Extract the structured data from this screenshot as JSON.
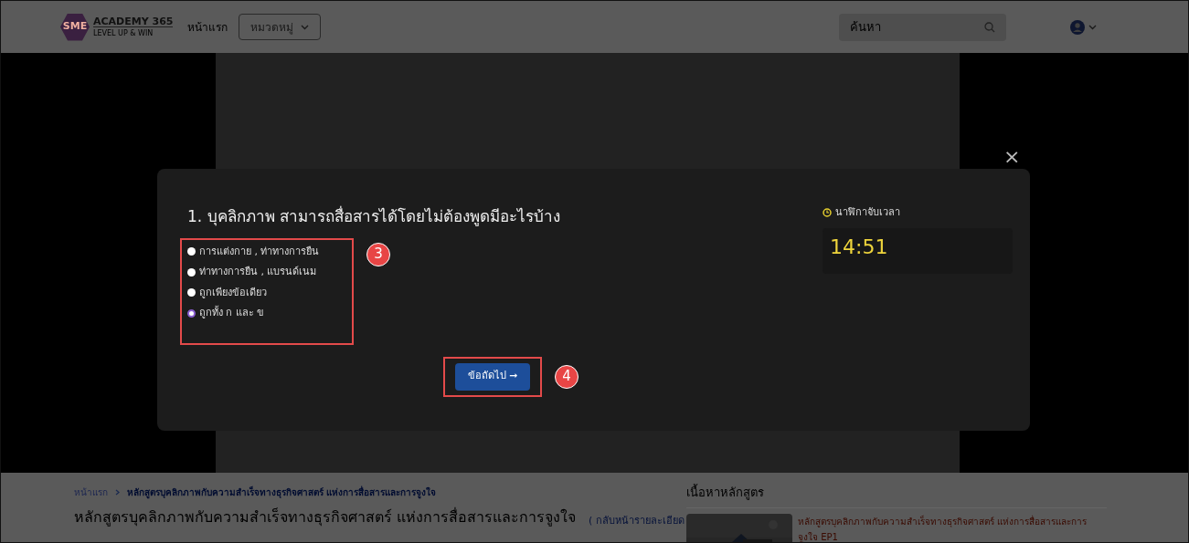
{
  "header": {
    "logo": {
      "mark": "SME",
      "name": "ACADEMY 365",
      "tagline": "LEVEL UP & WIN"
    },
    "nav": [
      {
        "label": "หน้าแรก",
        "kind": "link"
      },
      {
        "label": "หมวดหมู่",
        "kind": "dropdown"
      }
    ],
    "search": {
      "placeholder": "ค้นหา"
    }
  },
  "quiz": {
    "question": "1. บุคลิกภาพ สามารถสื่อสารได้โดยไม่ต้องพูดมีอะไรบ้าง",
    "options": [
      {
        "label": "การแต่งกาย , ท่าทางการยืน",
        "selected": false
      },
      {
        "label": "ท่าทางการยืน , แบรนด์เนม",
        "selected": false
      },
      {
        "label": "ถูกเพียงข้อเดียว",
        "selected": false
      },
      {
        "label": "ถูกทั้ง ก และ ข",
        "selected": true
      }
    ],
    "next_button": "ข้อถัดไป ➞",
    "timer_label": "นาฬิกาจับเวลา",
    "timer": "14:51",
    "close": "×"
  },
  "annotations": [
    {
      "label": "3"
    },
    {
      "label": "4"
    }
  ],
  "breadcrumb": [
    {
      "label": "หน้าแรก",
      "current": false
    },
    {
      "label": "หลักสูตรบุคลิกภาพกับความสำเร็จทางธุรกิจศาสตร์ แห่งการสื่อสารและการจูงใจ",
      "current": true
    }
  ],
  "course_title": "หลักสูตรบุคลิกภาพกับความสำเร็จทางธุรกิจศาสตร์ แห่งการสื่อสารและการจูงใจ",
  "back_link": "( กลับหน้ารายละเอียด",
  "contents": {
    "title": "เนื้อหาหลักสูตร",
    "items": [
      {
        "kind": "picture",
        "title": "หลักสูตรบุคลิกภาพกับความสำเร็จทางธุรกิจศาสตร์ แห่งการสื่อสารและการจูงใจ EP1"
      }
    ]
  }
}
